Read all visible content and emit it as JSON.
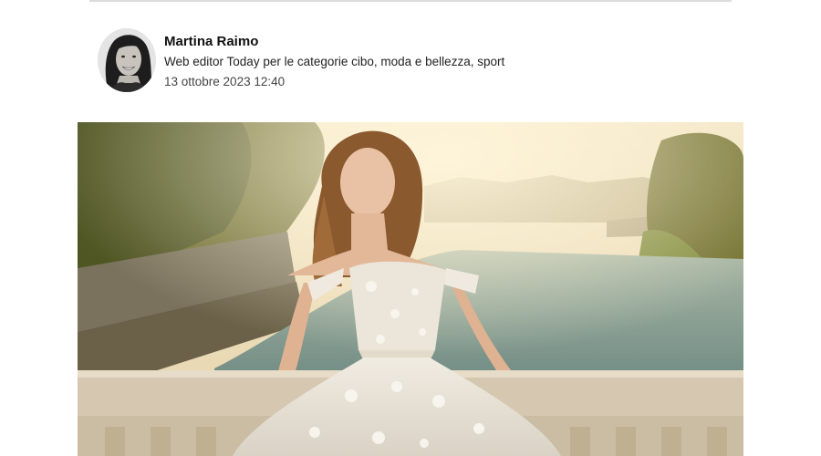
{
  "author": {
    "name": "Martina Raimo",
    "role": "Web editor Today per le categorie cibo, moda e bellezza, sport",
    "date": "13 ottobre 2023 12:40"
  },
  "hero_image": {
    "subject": "bride in off-shoulder tulle wedding gown on stone bridge balustrade over river at sunset"
  },
  "colors": {
    "rule": "#dcdcdc",
    "text": "#1a1a1a",
    "meta": "#444444"
  }
}
